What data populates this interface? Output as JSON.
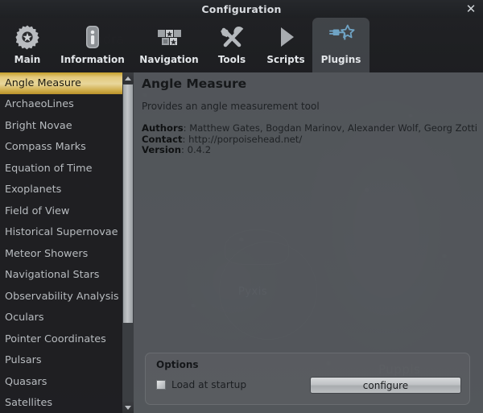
{
  "window": {
    "title": "Configuration",
    "close_label": "✕"
  },
  "tabs": [
    {
      "label": "Main",
      "icon": "gear-icon",
      "active": false
    },
    {
      "label": "Information",
      "icon": "info-icon",
      "active": false
    },
    {
      "label": "Navigation",
      "icon": "grid-star-icon",
      "active": false
    },
    {
      "label": "Tools",
      "icon": "tools-icon",
      "active": false
    },
    {
      "label": "Scripts",
      "icon": "play-icon",
      "active": false
    },
    {
      "label": "Plugins",
      "icon": "plug-star-icon",
      "active": true
    }
  ],
  "plugin_list": {
    "selected": "Angle Measure",
    "items": [
      "Angle Measure",
      "ArchaeoLines",
      "Bright Novae",
      "Compass Marks",
      "Equation of Time",
      "Exoplanets",
      "Field of View",
      "Historical Supernovae",
      "Meteor Showers",
      "Navigational Stars",
      "Observability Analysis",
      "Oculars",
      "Pointer Coordinates",
      "Pulsars",
      "Quasars",
      "Satellites"
    ],
    "scrollbar": {
      "up_arrow": "scroll-up-icon",
      "down_arrow": "scroll-down-icon"
    }
  },
  "details": {
    "title": "Angle Measure",
    "description": "Provides an angle measurement tool",
    "authors_label": "Authors",
    "authors_value": ": Matthew Gates, Bogdan Marinov, Alexander Wolf, Georg Zotti",
    "contact_label": "Contact",
    "contact_value": ": http://porpoisehead.net/",
    "version_label": "Version",
    "version_value": ": 0.4.2"
  },
  "options": {
    "title": "Options",
    "load_at_startup_label": "Load at startup",
    "load_at_startup_checked": false,
    "configure_label": "configure"
  },
  "background": {
    "constellation_label": "Pyxis",
    "ghost_words": [
      "ndra",
      "Puppis"
    ]
  },
  "colors": {
    "selection_gold": "#e3c97d",
    "panel_gray": "#5c6065",
    "list_dark": "#1e1e21",
    "accent_blue": "#6fa3c4"
  }
}
